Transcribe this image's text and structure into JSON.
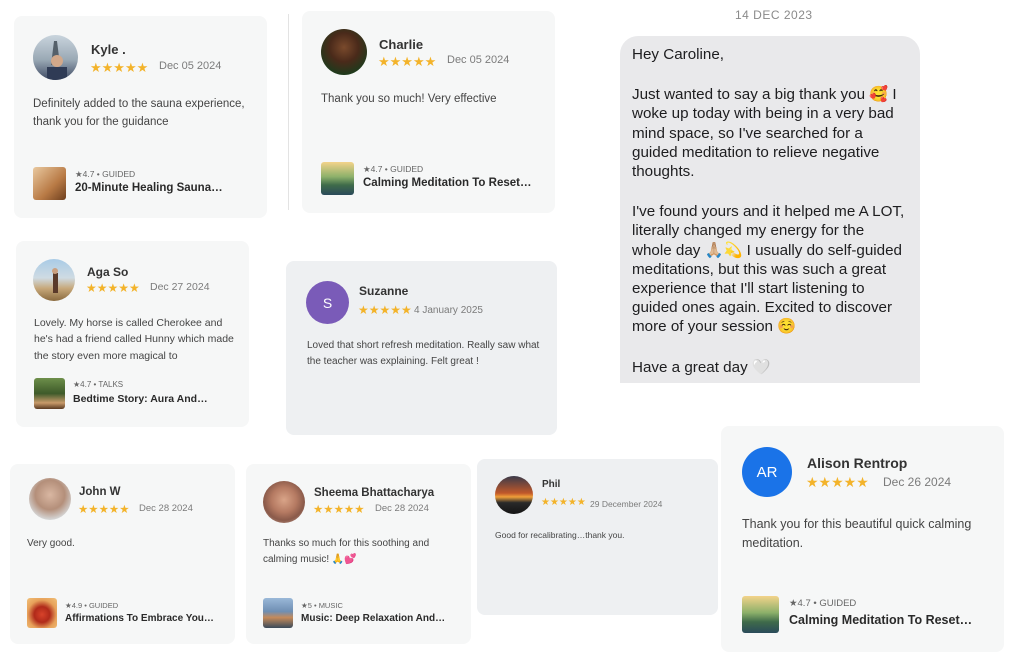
{
  "reviews": [
    {
      "name": "Kyle .",
      "stars": "★★★★★",
      "date": "Dec 05 2024",
      "text": "Definitely added to the sauna experience, thank you for the guidance",
      "meta": "★4.7 • GUIDED",
      "track": "20-Minute Healing Sauna…"
    },
    {
      "name": "Charlie",
      "stars": "★★★★★",
      "date": "Dec 05 2024",
      "text": "Thank you so much! Very effective",
      "meta": "★4.7 • GUIDED",
      "track": "Calming Meditation To Reset…"
    },
    {
      "name": "Aga So",
      "stars": "★★★★★",
      "date": "Dec 27 2024",
      "text": "Lovely. My horse is called Cherokee and he's had a friend called Hunny which made the story even more magical to",
      "meta": "★4.7 • TALKS",
      "track": "Bedtime Story: Aura And…"
    },
    {
      "name": "Suzanne",
      "initial": "S",
      "stars": "★★★★★",
      "date": "4 January 2025",
      "text": "Loved that short refresh meditation. Really saw what the teacher was explaining. Felt great !"
    },
    {
      "name": "John W",
      "stars": "★★★★★",
      "date": "Dec 28 2024",
      "text": "Very good.",
      "meta": "★4.9 • GUIDED",
      "track": "Affirmations To Embrace Your…"
    },
    {
      "name": "Sheema Bhattacharya",
      "stars": "★★★★★",
      "date": "Dec 28 2024",
      "text": "Thanks so much for this soothing and calming music! 🙏💕",
      "meta": "★5 • MUSIC",
      "track": "Music: Deep Relaxation And…"
    },
    {
      "name": "Phil",
      "stars": "★★★★★",
      "date": "29 December 2024",
      "text": "Good for recalibrating…thank you."
    },
    {
      "name": "Alison Rentrop",
      "initial": "AR",
      "stars": "★★★★★",
      "date": "Dec 26 2024",
      "text": "Thank you for this beautiful quick calming meditation.",
      "meta": "★4.7 • GUIDED",
      "track": "Calming Meditation To Reset…"
    }
  ],
  "chat": {
    "date": "14 DEC 2023",
    "paragraphs": [
      "Hey Caroline,",
      "Just wanted to say a big thank you 🥰 I woke up today with being in a very bad mind space, so I've searched for a guided meditation to relieve negative thoughts.",
      "I've found yours and it helped me A LOT, literally changed my energy for the whole day 🙏🏼💫 I usually do self-guided meditations, but this was such a great experience that I'll start listening to guided ones again. Excited to discover more of your session ☺️",
      "Have a great day 🤍"
    ]
  },
  "colors": {
    "star": "#f3b32a",
    "suzanne_avatar": "#7a5bb8",
    "alison_avatar": "#1a73e8",
    "bubble": "#e9e9eb"
  }
}
